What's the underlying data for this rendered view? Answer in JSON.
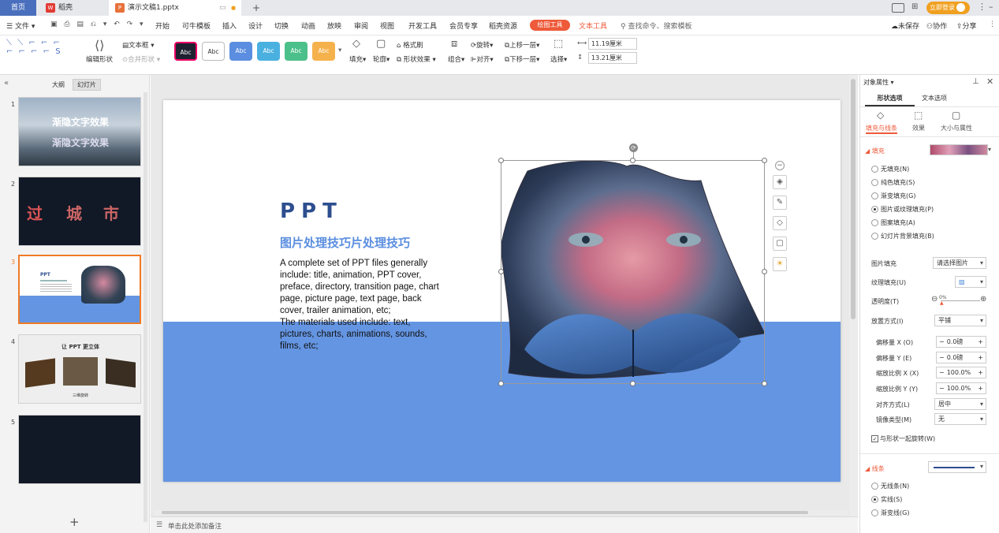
{
  "tabs": {
    "home": "首页",
    "daoke": "稻壳",
    "doc": "演示文稿1.pptx",
    "login": "立即登录"
  },
  "menu": {
    "file": "文件",
    "items": [
      "开始",
      "可牛模板",
      "插入",
      "设计",
      "切换",
      "动画",
      "放映",
      "审阅",
      "视图",
      "开发工具",
      "会员专享",
      "稻壳资源"
    ],
    "drawing_tools": "绘图工具",
    "text_tools": "文本工具",
    "search": "查找命令、搜索模板",
    "unsaved": "未保存",
    "collab": "协作",
    "share": "分享"
  },
  "ribbon": {
    "edit_shape": "编辑形状",
    "textbox": "文本框",
    "merge_shape": "合并形状",
    "styles": [
      "Abc",
      "Abc",
      "Abc",
      "Abc",
      "Abc",
      "Abc"
    ],
    "fill": "填充",
    "outline": "轮廓",
    "format_painter": "格式刷",
    "shape_effects": "形状效果",
    "group": "组合",
    "rotate": "旋转",
    "align": "对齐",
    "bring_forward": "上移一层",
    "send_backward": "下移一层",
    "select": "选择",
    "width": "11.19厘米",
    "height": "13.21厘米"
  },
  "left": {
    "outline": "大纲",
    "slides": "幻灯片",
    "nums": [
      "1",
      "2",
      "3",
      "4",
      "5"
    ],
    "t1_line1": "渐隐文字效果",
    "t1_line2": "渐隐文字效果",
    "t2_text": "城 市",
    "t2_prefix": "过",
    "t3_title": "PPT",
    "t4_title": "让 PPT 更立体",
    "t4_caption": "三维旋转"
  },
  "slide": {
    "title": "PPT",
    "subtitle": "图片处理技巧片处理技巧",
    "body": "A complete set of PPT files generally include: title, animation, PPT cover, preface, directory, transition page, chart page, picture page, text page, back cover, trailer animation, etc;\nThe materials used include: text, pictures, charts, animations, sounds, films, etc;"
  },
  "notes": "单击此处添加备注",
  "right": {
    "title": "对象属性",
    "tab_shape": "形状选项",
    "tab_text": "文本选项",
    "sub_fill_line": "填充与线条",
    "sub_effect": "效果",
    "sub_size": "大小与属性",
    "fill_header": "填充",
    "fill_options": [
      "无填充(N)",
      "纯色填充(S)",
      "渐变填充(G)",
      "图片或纹理填充(P)",
      "图案填充(A)",
      "幻灯片背景填充(B)"
    ],
    "fill_selected": 3,
    "pic_fill": "图片填充",
    "pic_fill_val": "请选择图片",
    "texture_fill": "纹理填充(U)",
    "transparency": "透明度(T)",
    "transparency_val": "0%",
    "placement": "放置方式(I)",
    "placement_val": "平铺",
    "offset_x": "偏移量 X (O)",
    "offset_x_val": "0.0磅",
    "offset_y": "偏移量 Y (E)",
    "offset_y_val": "0.0磅",
    "scale_x": "缩放比例 X (X)",
    "scale_x_val": "100.0%",
    "scale_y": "缩放比例 Y (Y)",
    "scale_y_val": "100.0%",
    "align": "对齐方式(L)",
    "align_val": "居中",
    "mirror": "镜像类型(M)",
    "mirror_val": "无",
    "rotate_with": "与形状一起旋转(W)",
    "line_header": "线条",
    "line_options": [
      "无线条(N)",
      "实线(S)",
      "渐变线(G)"
    ],
    "line_selected": 1
  },
  "colors": {
    "accent": "#f07a26",
    "brand_blue": "#4a6fbd",
    "slide_title": "#2d4e8f",
    "slide_subtitle": "#5b8ee0",
    "band": "#6495e2"
  }
}
